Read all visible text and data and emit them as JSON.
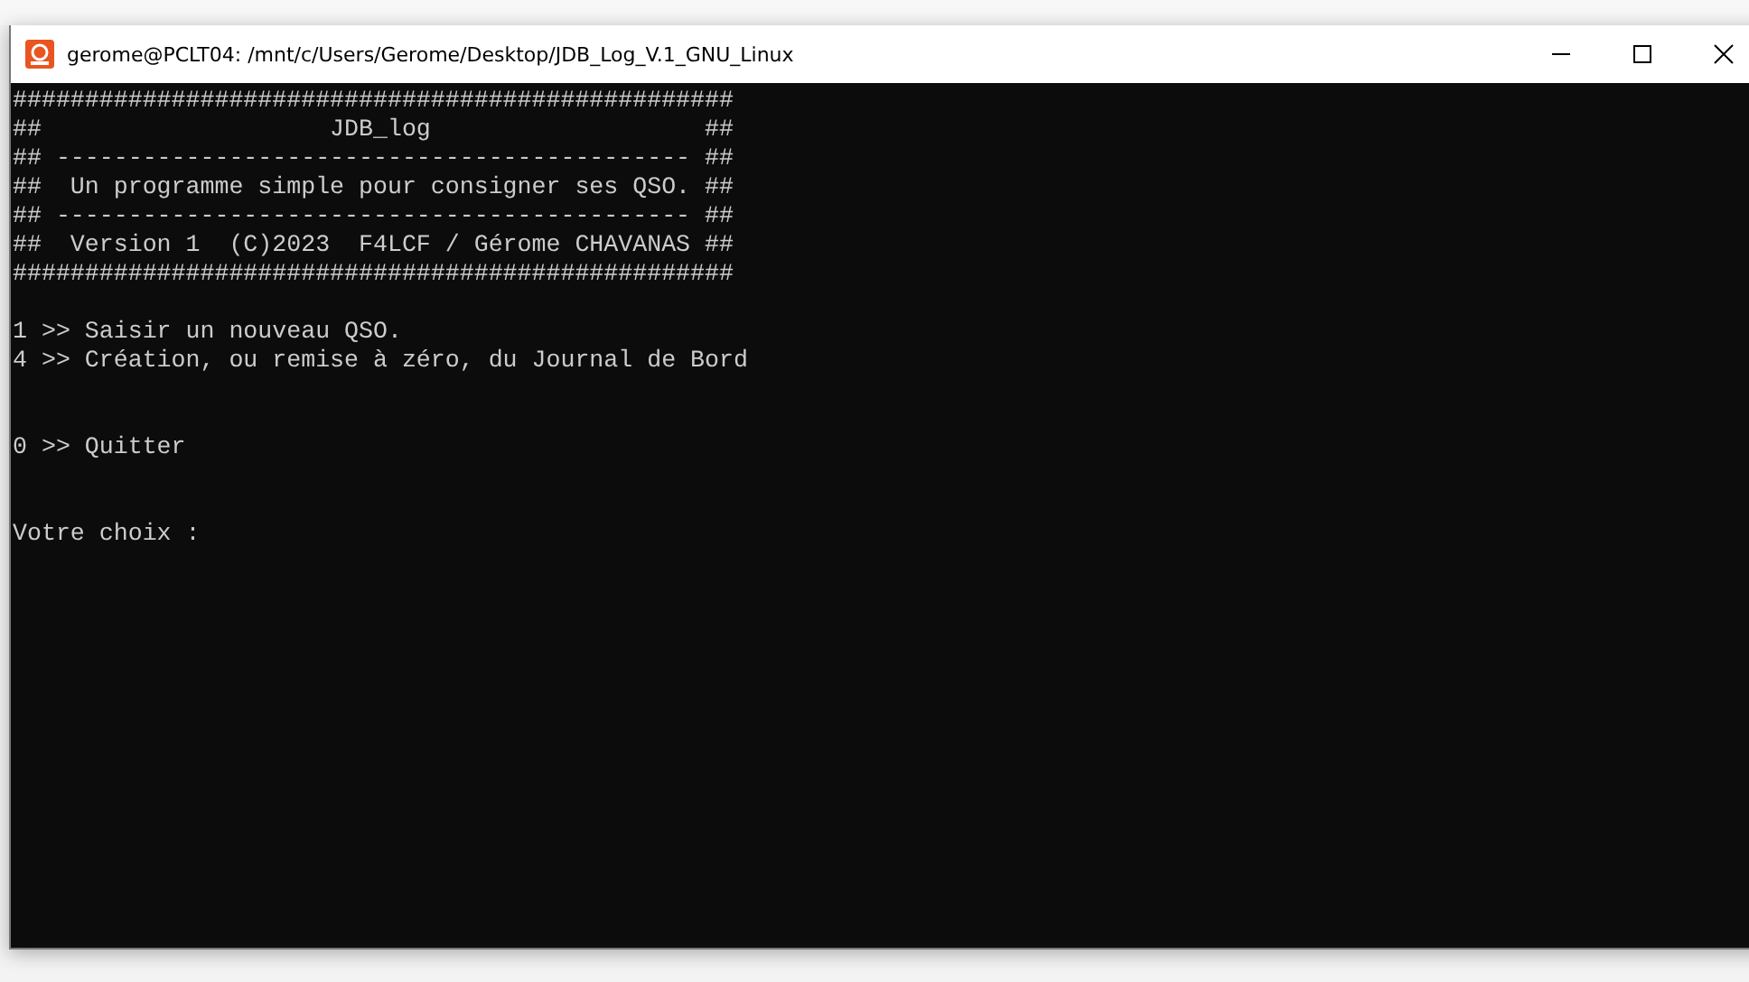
{
  "window": {
    "title": "gerome@PCLT04: /mnt/c/Users/Gerome/Desktop/JDB_Log_V.1_GNU_Linux"
  },
  "terminal": {
    "banner": [
      "##################################################",
      "##                    JDB_log                   ##",
      "## -------------------------------------------- ##",
      "##  Un programme simple pour consigner ses QSO. ##",
      "## -------------------------------------------- ##",
      "##  Version 1  (C)2023  F4LCF / Gérome CHAVANAS ##",
      "##################################################"
    ],
    "menu_groups": [
      [
        "1 >> Saisir un nouveau QSO.",
        "4 >> Création, ou remise à zéro, du Journal de Bord"
      ],
      [
        "0 >> Quitter"
      ]
    ],
    "prompt": "Votre choix :"
  }
}
